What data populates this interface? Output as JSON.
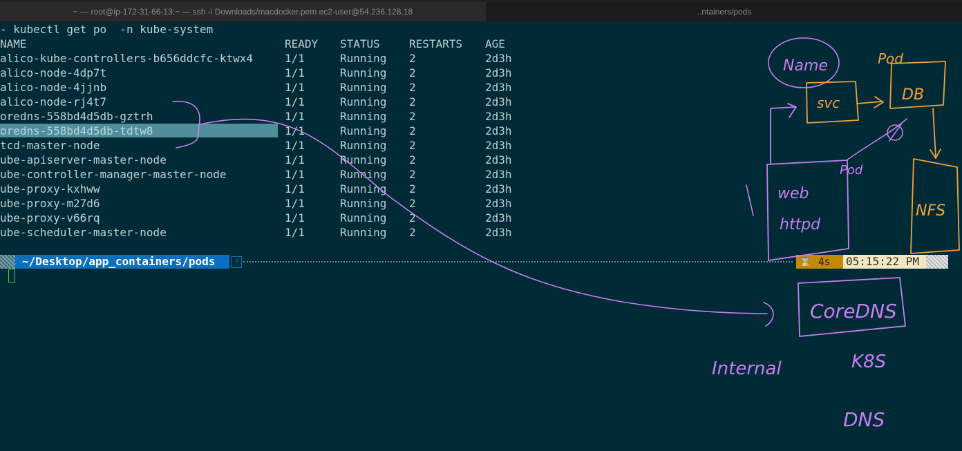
{
  "tabs": [
    {
      "title": "~ — root@ip-172-31-66-13:~ — ssh -i Downloads/macdocker.pem ec2-user@54.236.128.18"
    },
    {
      "title": "..ntainers/pods"
    }
  ],
  "terminal": {
    "command": "- kubectl get po  -n kube-system",
    "headers": [
      "NAME",
      "READY",
      "STATUS",
      "RESTARTS",
      "AGE"
    ],
    "rows": [
      [
        "alico-kube-controllers-b656ddcfc-ktwx4",
        "1/1",
        "Running",
        "2",
        "2d3h"
      ],
      [
        "alico-node-4dp7t",
        "1/1",
        "Running",
        "2",
        "2d3h"
      ],
      [
        "alico-node-4jjnb",
        "1/1",
        "Running",
        "2",
        "2d3h"
      ],
      [
        "alico-node-rj4t7",
        "1/1",
        "Running",
        "2",
        "2d3h"
      ],
      [
        "oredns-558bd4d5db-gztrh",
        "1/1",
        "Running",
        "2",
        "2d3h"
      ],
      [
        "oredns-558bd4d5db-tdtw8",
        "1/1",
        "Running",
        "2",
        "2d3h"
      ],
      [
        "tcd-master-node",
        "1/1",
        "Running",
        "2",
        "2d3h"
      ],
      [
        "ube-apiserver-master-node",
        "1/1",
        "Running",
        "2",
        "2d3h"
      ],
      [
        "ube-controller-manager-master-node",
        "1/1",
        "Running",
        "2",
        "2d3h"
      ],
      [
        "ube-proxy-kxhww",
        "1/1",
        "Running",
        "2",
        "2d3h"
      ],
      [
        "ube-proxy-m27d6",
        "1/1",
        "Running",
        "2",
        "2d3h"
      ],
      [
        "ube-proxy-v66rq",
        "1/1",
        "Running",
        "2",
        "2d3h"
      ],
      [
        "ube-scheduler-master-node",
        "1/1",
        "Running",
        "2",
        "2d3h"
      ]
    ],
    "selected_row": 5,
    "prompt": {
      "path_prefix": "~/Desktop/app_containers/",
      "path_dir": "pods",
      "help_glyph": "?",
      "elapsed": "4s",
      "clock": "05:15:22 PM"
    }
  },
  "annotations": {
    "labels": [
      "Name",
      "Pod",
      "svc",
      "DB",
      "Pod",
      "web",
      "httpd",
      "NFS",
      "CoreDNS",
      "Internal",
      "K8S",
      "DNS"
    ],
    "colors": {
      "purple": "#c97df0",
      "orange": "#f2a23a"
    }
  },
  "colors": {
    "background": "#002b36",
    "text": "#c0d0d4",
    "selection": "#4f8e9a",
    "prompt_path": "#0a6fbf",
    "prompt_time": "#c48a06",
    "prompt_clock": "#f1e7c0",
    "cursor": "#3fd14a"
  }
}
